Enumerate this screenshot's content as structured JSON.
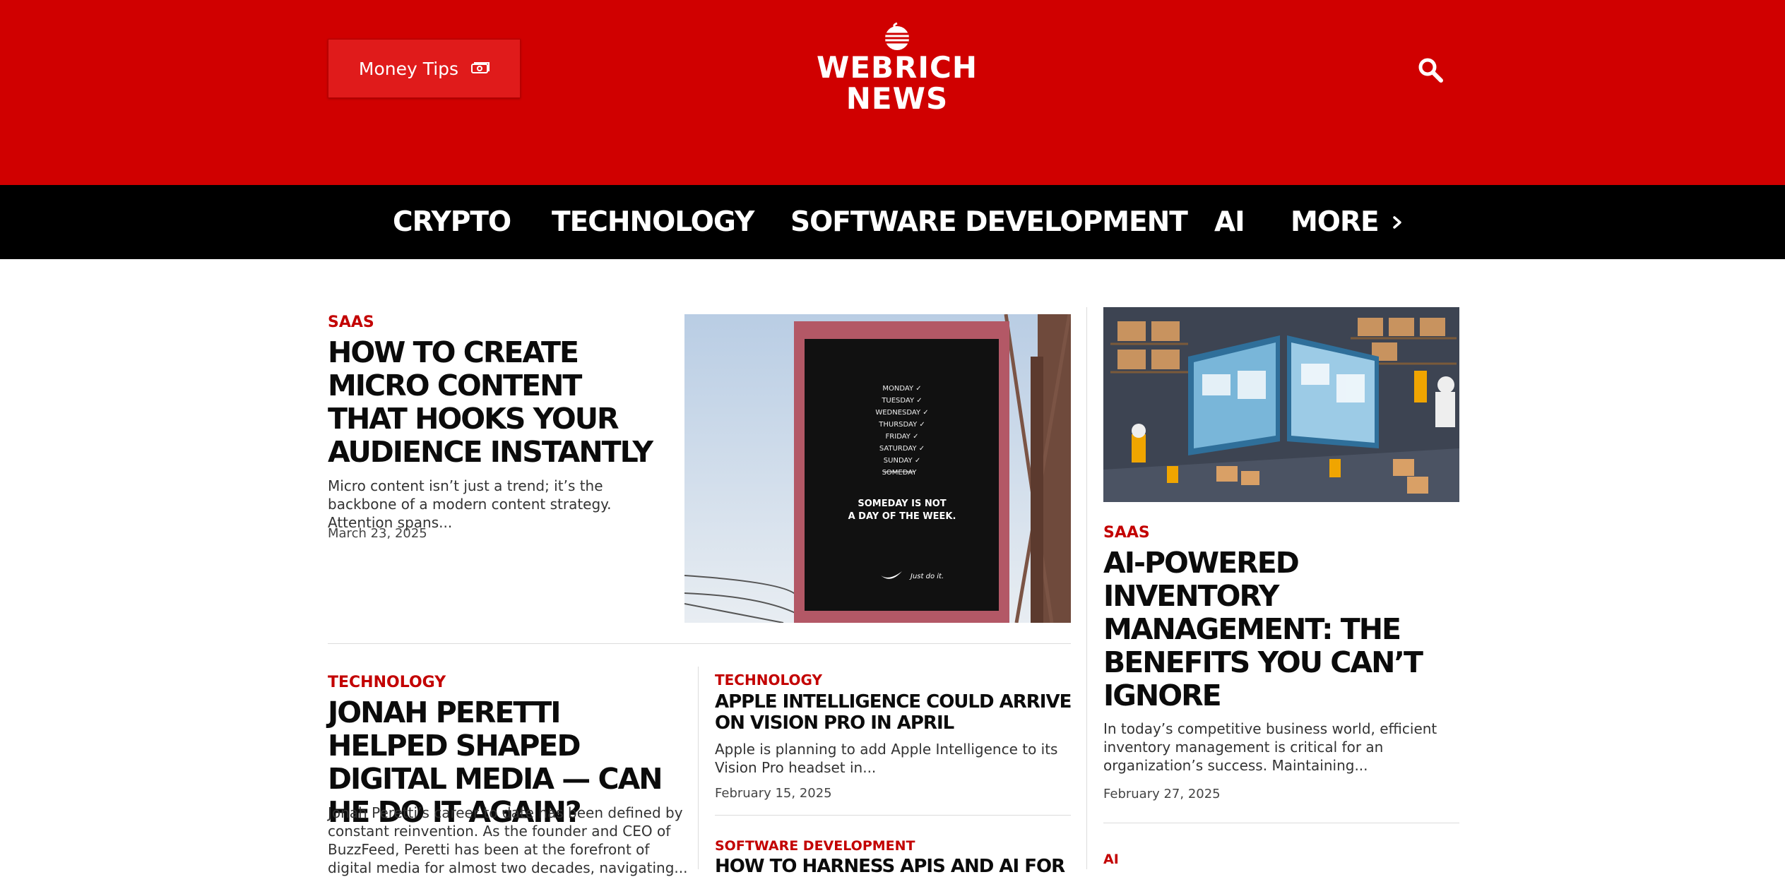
{
  "header": {
    "money_tips_label": "Money Tips",
    "logo_line1": "WEBRICH",
    "logo_line2": "NEWS",
    "brand_color": "#d00000",
    "nav_bg": "#000000"
  },
  "nav": {
    "items": [
      {
        "label": "CRYPTO"
      },
      {
        "label": "TECHNOLOGY"
      },
      {
        "label": "SOFTWARE DEVELOPMENT"
      },
      {
        "label": "AI"
      }
    ],
    "more_label": "MORE"
  },
  "featured": {
    "category": "SAAS",
    "title": "HOW TO CREATE MICRO CONTENT THAT HOOKS YOUR AUDIENCE INSTANTLY",
    "excerpt": "Micro content isn’t just a trend; it’s the backbone of a modern content strategy.  Attention spans...",
    "date": "March 23, 2025",
    "image": {
      "days": [
        "MONDAY ✓",
        "TUESDAY ✓",
        "WEDNESDAY ✓",
        "THURSDAY ✓",
        "FRIDAY ✓",
        "SATURDAY ✓",
        "SUNDAY ✓",
        "SOMEDAY"
      ],
      "tagline_1": "SOMEDAY IS NOT",
      "tagline_2": "A DAY OF THE WEEK.",
      "slogan": "Just do it."
    }
  },
  "second": {
    "category": "TECHNOLOGY",
    "title": "JONAH PERETTI HELPED SHAPED DIGITAL MEDIA — CAN HE DO IT AGAIN?",
    "excerpt": "Jonah Peretti’s career to date has been defined by constant reinvention. As the founder and CEO of BuzzFeed, Peretti has been at the forefront of digital media for almost two decades, navigating..."
  },
  "third": {
    "category": "TECHNOLOGY",
    "title": "APPLE INTELLIGENCE COULD ARRIVE ON VISION PRO IN APRIL",
    "excerpt": "Apple is planning to add Apple Intelligence to its Vision Pro headset in...",
    "date": "February 15, 2025"
  },
  "fourth": {
    "category": "SOFTWARE DEVELOPMENT",
    "title": "HOW TO HARNESS APIS AND AI FOR"
  },
  "sidebar": {
    "category": "SAAS",
    "title": "AI-POWERED INVENTORY MANAGEMENT: THE BENEFITS YOU CAN’T IGNORE",
    "excerpt": "In today’s competitive business world, efficient inventory management is critical for an organization’s success. Maintaining...",
    "date": "February 27, 2025",
    "next_category": "AI"
  }
}
